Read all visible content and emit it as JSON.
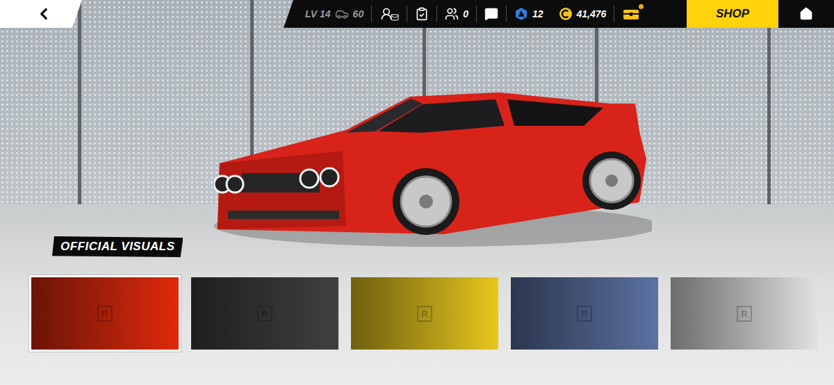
{
  "top_bar": {
    "level": "LV 14",
    "cars": "60",
    "friends": "0",
    "tokens": "12",
    "credits": "41,476",
    "chest_notification": true,
    "shop": "SHOP"
  },
  "section_label": "OFFICIAL VISUALS",
  "swatches": [
    {
      "badge": "R",
      "selected": true,
      "color": "#e02a0c"
    },
    {
      "badge": "R",
      "selected": false,
      "color": "#404040"
    },
    {
      "badge": "R",
      "selected": false,
      "color": "#e8c81e"
    },
    {
      "badge": "R",
      "selected": false,
      "color": "#5c72a2"
    },
    {
      "badge": "R",
      "selected": false,
      "color": "#e2e2e2"
    }
  ]
}
